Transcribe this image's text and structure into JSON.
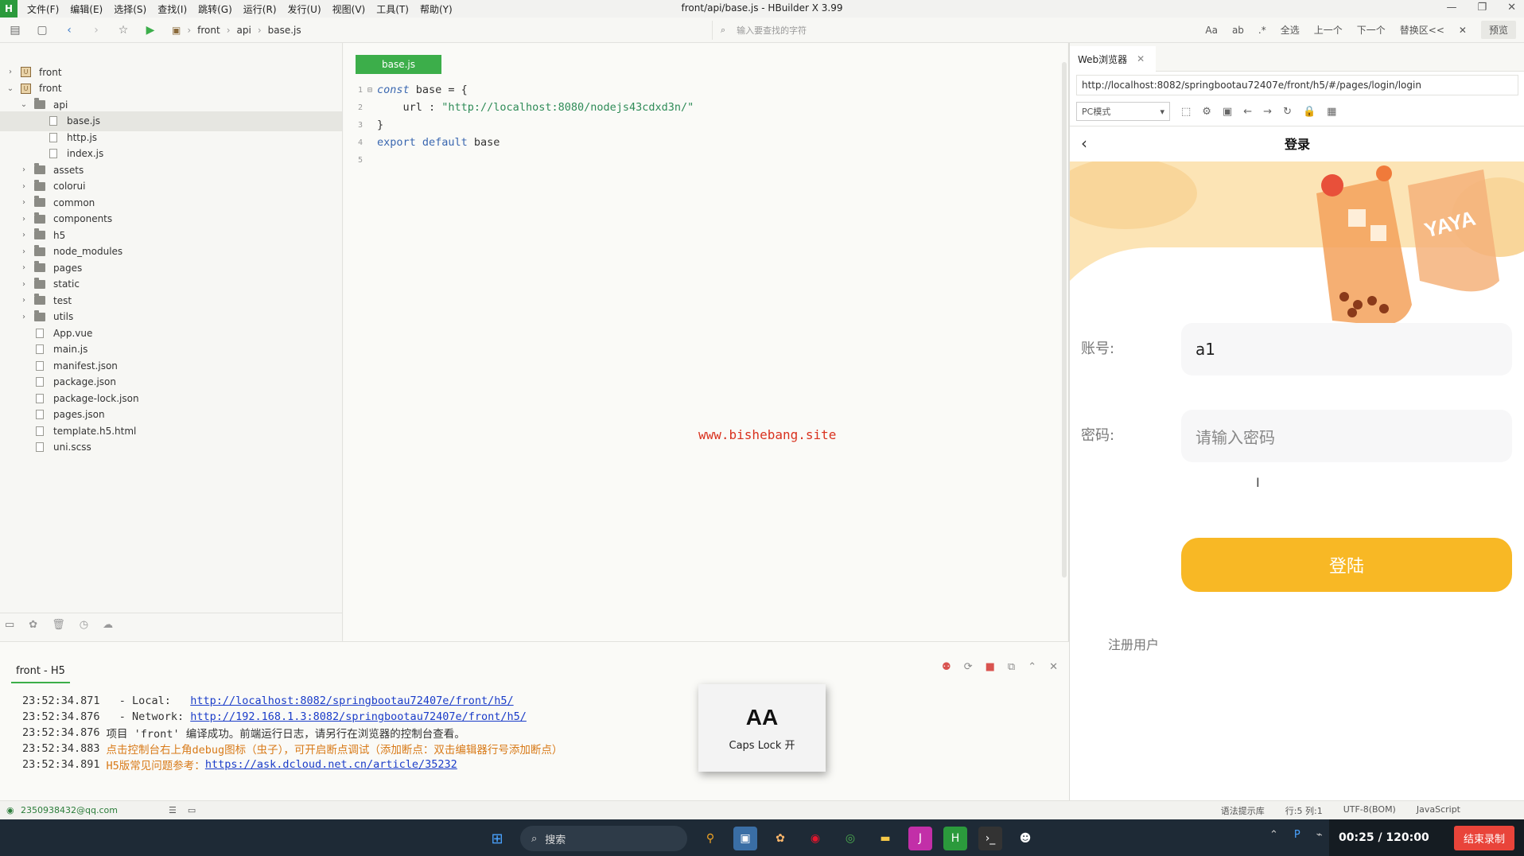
{
  "window": {
    "title": "front/api/base.js - HBuilder X 3.99",
    "menu": [
      "文件(F)",
      "编辑(E)",
      "选择(S)",
      "查找(I)",
      "跳转(G)",
      "运行(R)",
      "发行(U)",
      "视图(V)",
      "工具(T)",
      "帮助(Y)"
    ]
  },
  "toolbar": {
    "breadcrumb": [
      "front",
      "api",
      "base.js"
    ],
    "find_placeholder": "输入要查找的字符",
    "find_tools": [
      "全选",
      "上一个",
      "下一个",
      "替换区<<"
    ],
    "preview_label": "预览"
  },
  "tree": {
    "items": [
      {
        "label": "front",
        "kind": "project",
        "depth": 0,
        "arrow": "›"
      },
      {
        "label": "front",
        "kind": "project",
        "depth": 0,
        "arrow": "⌄"
      },
      {
        "label": "api",
        "kind": "folder",
        "depth": 1,
        "arrow": "⌄"
      },
      {
        "label": "base.js",
        "kind": "file",
        "depth": 2,
        "arrow": "",
        "selected": true
      },
      {
        "label": "http.js",
        "kind": "file",
        "depth": 2,
        "arrow": ""
      },
      {
        "label": "index.js",
        "kind": "file",
        "depth": 2,
        "arrow": ""
      },
      {
        "label": "assets",
        "kind": "folder",
        "depth": 1,
        "arrow": "›"
      },
      {
        "label": "colorui",
        "kind": "folder",
        "depth": 1,
        "arrow": "›"
      },
      {
        "label": "common",
        "kind": "folder",
        "depth": 1,
        "arrow": "›"
      },
      {
        "label": "components",
        "kind": "folder",
        "depth": 1,
        "arrow": "›"
      },
      {
        "label": "h5",
        "kind": "folder",
        "depth": 1,
        "arrow": "›"
      },
      {
        "label": "node_modules",
        "kind": "folder",
        "depth": 1,
        "arrow": "›"
      },
      {
        "label": "pages",
        "kind": "folder",
        "depth": 1,
        "arrow": "›"
      },
      {
        "label": "static",
        "kind": "folder",
        "depth": 1,
        "arrow": "›"
      },
      {
        "label": "test",
        "kind": "folder",
        "depth": 1,
        "arrow": "›"
      },
      {
        "label": "utils",
        "kind": "folder",
        "depth": 1,
        "arrow": "›"
      },
      {
        "label": "App.vue",
        "kind": "file",
        "depth": 1,
        "arrow": ""
      },
      {
        "label": "main.js",
        "kind": "file",
        "depth": 1,
        "arrow": ""
      },
      {
        "label": "manifest.json",
        "kind": "file",
        "depth": 1,
        "arrow": ""
      },
      {
        "label": "package.json",
        "kind": "file",
        "depth": 1,
        "arrow": ""
      },
      {
        "label": "package-lock.json",
        "kind": "file",
        "depth": 1,
        "arrow": ""
      },
      {
        "label": "pages.json",
        "kind": "file",
        "depth": 1,
        "arrow": ""
      },
      {
        "label": "template.h5.html",
        "kind": "file",
        "depth": 1,
        "arrow": ""
      },
      {
        "label": "uni.scss",
        "kind": "file",
        "depth": 1,
        "arrow": ""
      }
    ]
  },
  "editor": {
    "tab_label": "base.js",
    "lines": [
      {
        "num": "1",
        "fold": "⊟",
        "parts": [
          {
            "t": "const",
            "c": "kw"
          },
          {
            "t": " base = {",
            "c": "plain"
          }
        ]
      },
      {
        "num": "2",
        "fold": "",
        "parts": [
          {
            "t": "    url : ",
            "c": "plain"
          },
          {
            "t": "\"http://localhost:8080/nodejs43cdxd3n/\"",
            "c": "str"
          }
        ]
      },
      {
        "num": "3",
        "fold": "",
        "parts": [
          {
            "t": "}",
            "c": "plain"
          }
        ]
      },
      {
        "num": "4",
        "fold": "",
        "parts": [
          {
            "t": "export default",
            "c": "kw2"
          },
          {
            "t": " base",
            "c": "plain"
          }
        ]
      },
      {
        "num": "5",
        "fold": "",
        "parts": []
      }
    ],
    "watermark": "www.bishebang.site"
  },
  "console": {
    "tab_label": "front - H5",
    "lines": [
      {
        "time": "23:52:34.871",
        "parts": [
          {
            "t": "  - Local:   ",
            "c": "plain"
          },
          {
            "t": "http://localhost:8082/springbootau72407e/front/h5/",
            "c": "link"
          }
        ]
      },
      {
        "time": "23:52:34.876",
        "parts": [
          {
            "t": "  - Network: ",
            "c": "plain"
          },
          {
            "t": "http://192.168.1.3:8082/springbootau72407e/front/h5/",
            "c": "link"
          }
        ]
      },
      {
        "time": "23:52:34.876",
        "parts": [
          {
            "t": "项目 'front' 编译成功。前端运行日志，请另行在浏览器的控制台查看。",
            "c": "plain"
          }
        ]
      },
      {
        "time": "23:52:34.883",
        "parts": [
          {
            "t": "点击控制台右上角debug图标（虫子），可开启断点调试（添加断点：双击编辑器行号添加断点）",
            "c": "orange"
          }
        ]
      },
      {
        "time": "23:52:34.891",
        "parts": [
          {
            "t": "H5版常见问题参考：",
            "c": "orange"
          },
          {
            "t": "https://ask.dcloud.net.cn/article/35232",
            "c": "link"
          }
        ]
      }
    ]
  },
  "capslock": {
    "glyph": "AA",
    "label": "Caps Lock 开"
  },
  "statusbar": {
    "email": "2350938432@qq.com",
    "right": [
      "语法提示库",
      "行:5  列:1",
      "UTF-8(BOM)",
      "JavaScript"
    ]
  },
  "browser": {
    "tab_label": "Web浏览器",
    "url": "http://localhost:8082/springbootau72407e/front/h5/#/pages/login/login",
    "mode": "PC模式",
    "page": {
      "title": "登录",
      "account_label": "账号:",
      "account_value": "a1",
      "password_label": "密码:",
      "password_placeholder": "请输入密码",
      "login_button": "登陆",
      "register_link": "注册用户"
    }
  },
  "taskbar": {
    "search_label": "搜索",
    "recorder_time": "00:25 / 120:00",
    "recorder_button": "结束录制"
  },
  "colors": {
    "accent": "#3cae4a",
    "login_button": "#f8b825",
    "link": "#1a3cc9",
    "warning": "#d87a18",
    "watermark": "#d9321f"
  }
}
